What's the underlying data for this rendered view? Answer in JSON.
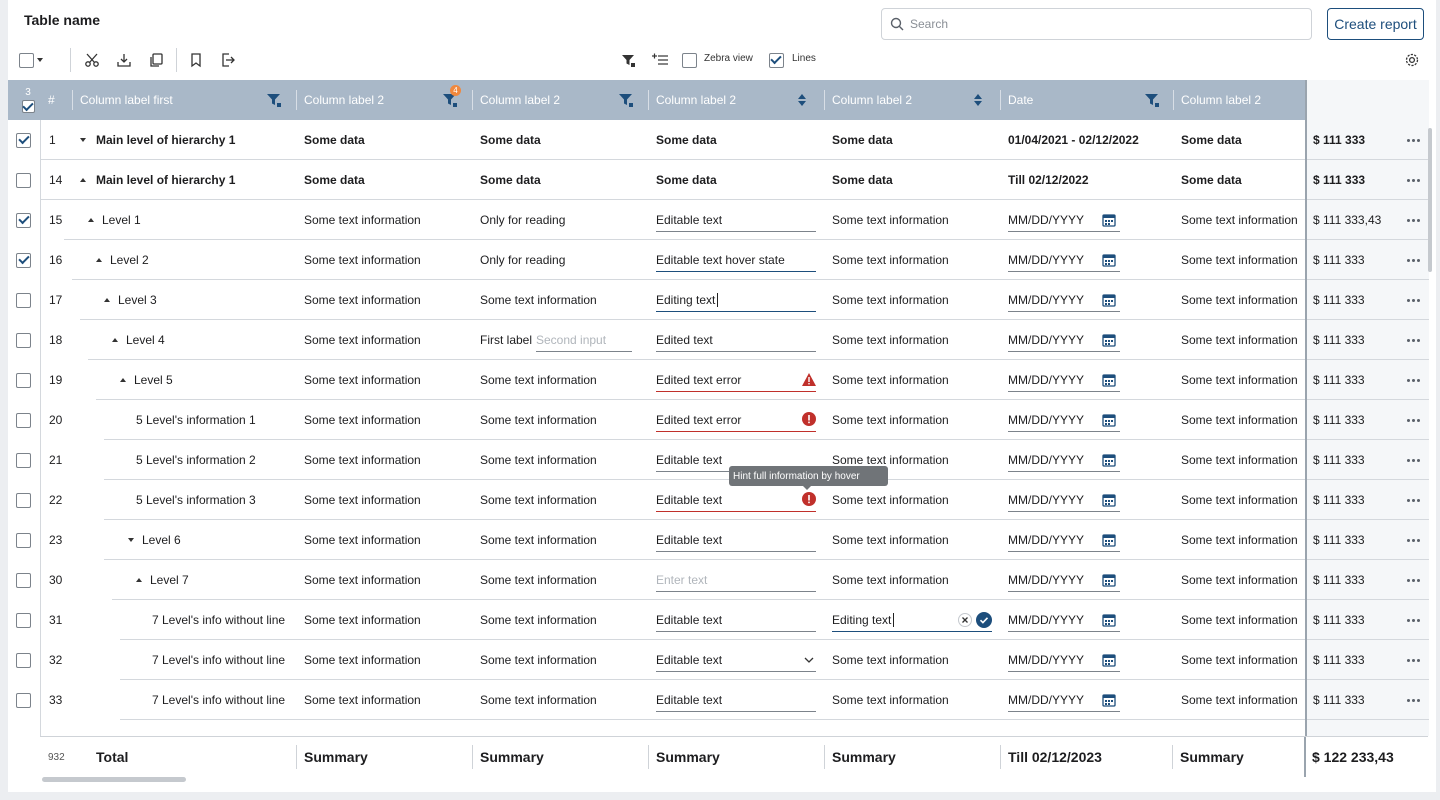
{
  "header": {
    "title": "Table name",
    "search_placeholder": "Search",
    "create_report_label": "Create report"
  },
  "toolbar": {
    "zebra_label": "Zebra view",
    "zebra_checked": false,
    "lines_label": "Lines",
    "lines_checked": true
  },
  "selection": {
    "count": "3"
  },
  "columns": [
    {
      "label": "#"
    },
    {
      "label": "Column label first",
      "icon": "filter-icon"
    },
    {
      "label": "Column label 2",
      "icon": "filter-icon",
      "badge": "4"
    },
    {
      "label": "Column label 2",
      "icon": "filter-icon"
    },
    {
      "label": "Column label 2",
      "icon": "sort-icon"
    },
    {
      "label": "Column label 2",
      "icon": "sort-icon"
    },
    {
      "label": "Date",
      "icon": "filter-icon"
    },
    {
      "label": "Column label 2"
    },
    {
      "label": "Total"
    }
  ],
  "rows": [
    {
      "checked": true,
      "num": "1",
      "indent": 0,
      "toggle": "down",
      "name": "Main level of hierarchy 1",
      "c2": "Some data",
      "c3": "Some data",
      "c4": "Some data",
      "c5": "Some data",
      "date": "01/04/2021 - 02/12/2022",
      "c7": "Some data",
      "total": "$ 111 333",
      "bold": true
    },
    {
      "checked": false,
      "num": "14",
      "indent": 0,
      "toggle": "up",
      "name": "Main level of hierarchy 1",
      "c2": "Some data",
      "c3": "Some data",
      "c4": "Some data",
      "c5": "Some data",
      "date": "Till 02/12/2022",
      "c7": "Some data",
      "total": "$ 111 333",
      "bold": true
    },
    {
      "checked": true,
      "num": "15",
      "indent": 1,
      "toggle": "up",
      "name": "Level 1",
      "c2": "Some text information",
      "c3": "Only for reading",
      "c4": "Editable text",
      "c4type": "edit",
      "c5": "Some text information",
      "date": "MM/DD/YYYY",
      "c7": "Some text information",
      "total": "$ 111 333,43"
    },
    {
      "checked": true,
      "num": "16",
      "indent": 2,
      "toggle": "up",
      "name": "Level 2",
      "c2": "Some text information",
      "c3": "Only for reading",
      "c4": "Editable text hover state",
      "c4type": "hover",
      "c5": "Some text information",
      "date": "MM/DD/YYYY",
      "c7": "Some text information",
      "total": "$ 111 333"
    },
    {
      "checked": false,
      "num": "17",
      "indent": 3,
      "toggle": "up",
      "name": "Level 3",
      "c2": "Some text information",
      "c3": "Some text information",
      "c4": "Editing text",
      "c4type": "active",
      "c5": "Some text information",
      "date": "MM/DD/YYYY",
      "c7": "Some text information",
      "total": "$ 111 333"
    },
    {
      "checked": false,
      "num": "18",
      "indent": 4,
      "toggle": "up",
      "name": "Level 4",
      "c2": "Some text information",
      "c3": "First label",
      "c3b": "Second input",
      "c4": "Edited text",
      "c4type": "edit",
      "c5": "Some text information",
      "date": "MM/DD/YYYY",
      "c7": "Some text information",
      "total": "$ 111 333"
    },
    {
      "checked": false,
      "num": "19",
      "indent": 5,
      "toggle": "up",
      "name": "Level 5",
      "c2": "Some text information",
      "c3": "Some text information",
      "c4": "Edited text error",
      "c4type": "warn",
      "c5": "Some text information",
      "date": "MM/DD/YYYY",
      "c7": "Some text information",
      "total": "$ 111 333"
    },
    {
      "checked": false,
      "num": "20",
      "indent": 6,
      "toggle": "",
      "name": "5 Level's information 1",
      "c2": "Some text information",
      "c3": "Some text information",
      "c4": "Edited text error",
      "c4type": "err",
      "c5": "Some text information",
      "date": "MM/DD/YYYY",
      "c7": "Some text information",
      "total": "$ 111 333"
    },
    {
      "checked": false,
      "num": "21",
      "indent": 6,
      "toggle": "",
      "name": "5 Level's information 2",
      "c2": "Some text information",
      "c3": "Some text information",
      "c4": "Editable text",
      "c4type": "edit",
      "c5": "Some text information",
      "date": "MM/DD/YYYY",
      "c7": "Some text information",
      "total": "$ 111 333"
    },
    {
      "checked": false,
      "num": "22",
      "indent": 6,
      "toggle": "",
      "name": "5 Level's information 3",
      "c2": "Some text information",
      "c3": "Some text information",
      "c4": "Editable text",
      "c4type": "err",
      "c5": "Some text information",
      "date": "MM/DD/YYYY",
      "c7": "Some text information",
      "total": "$ 111 333"
    },
    {
      "checked": false,
      "num": "23",
      "indent": 6,
      "toggle": "down",
      "name": "Level 6",
      "c2": "Some text information",
      "c3": "Some text information",
      "c4": "Editable text",
      "c4type": "edit",
      "c5": "Some text information",
      "date": "MM/DD/YYYY",
      "c7": "Some text information",
      "total": "$ 111 333"
    },
    {
      "checked": false,
      "num": "30",
      "indent": 7,
      "toggle": "up",
      "name": "Level 7",
      "c2": "Some text information",
      "c3": "Some text information",
      "c4": "",
      "c4ph": "Enter text",
      "c4type": "edit",
      "c5": "Some text information",
      "date": "MM/DD/YYYY",
      "c7": "Some text information",
      "total": "$ 111 333"
    },
    {
      "checked": false,
      "num": "31",
      "indent": 8,
      "toggle": "",
      "name": "7 Level's info without line",
      "c2": "Some text information",
      "c3": "Some text information",
      "c4": "Editable text",
      "c4type": "edit",
      "c5": "Editing text",
      "c5type": "editing",
      "date": "MM/DD/YYYY",
      "c7": "Some text information",
      "total": "$ 111 333"
    },
    {
      "checked": false,
      "num": "32",
      "indent": 8,
      "toggle": "",
      "name": "7 Level's info without line",
      "c2": "Some text information",
      "c3": "Some text information",
      "c4": "Editable text",
      "c4type": "select",
      "c5": "Some text information",
      "date": "MM/DD/YYYY",
      "c7": "Some text information",
      "total": "$ 111 333"
    },
    {
      "checked": false,
      "num": "33",
      "indent": 8,
      "toggle": "",
      "name": "7 Level's info without line",
      "c2": "Some text information",
      "c3": "Some text information",
      "c4": "Editable text",
      "c4type": "edit",
      "c5": "Some text information",
      "date": "MM/DD/YYYY",
      "c7": "Some text information",
      "total": "$ 111 333"
    }
  ],
  "tooltip": "Hint full information by hover",
  "footer": {
    "count": "932",
    "label": "Total",
    "c2": "Summary",
    "c3": "Summary",
    "c4": "Summary",
    "c5": "Summary",
    "date": "Till 02/12/2023",
    "c7": "Summary",
    "total": "$ 122 233,43"
  },
  "colors": {
    "accent": "#1d4e7c",
    "header_bg": "#a9b8c8",
    "error": "#c0302b",
    "badge": "#f0883e"
  }
}
